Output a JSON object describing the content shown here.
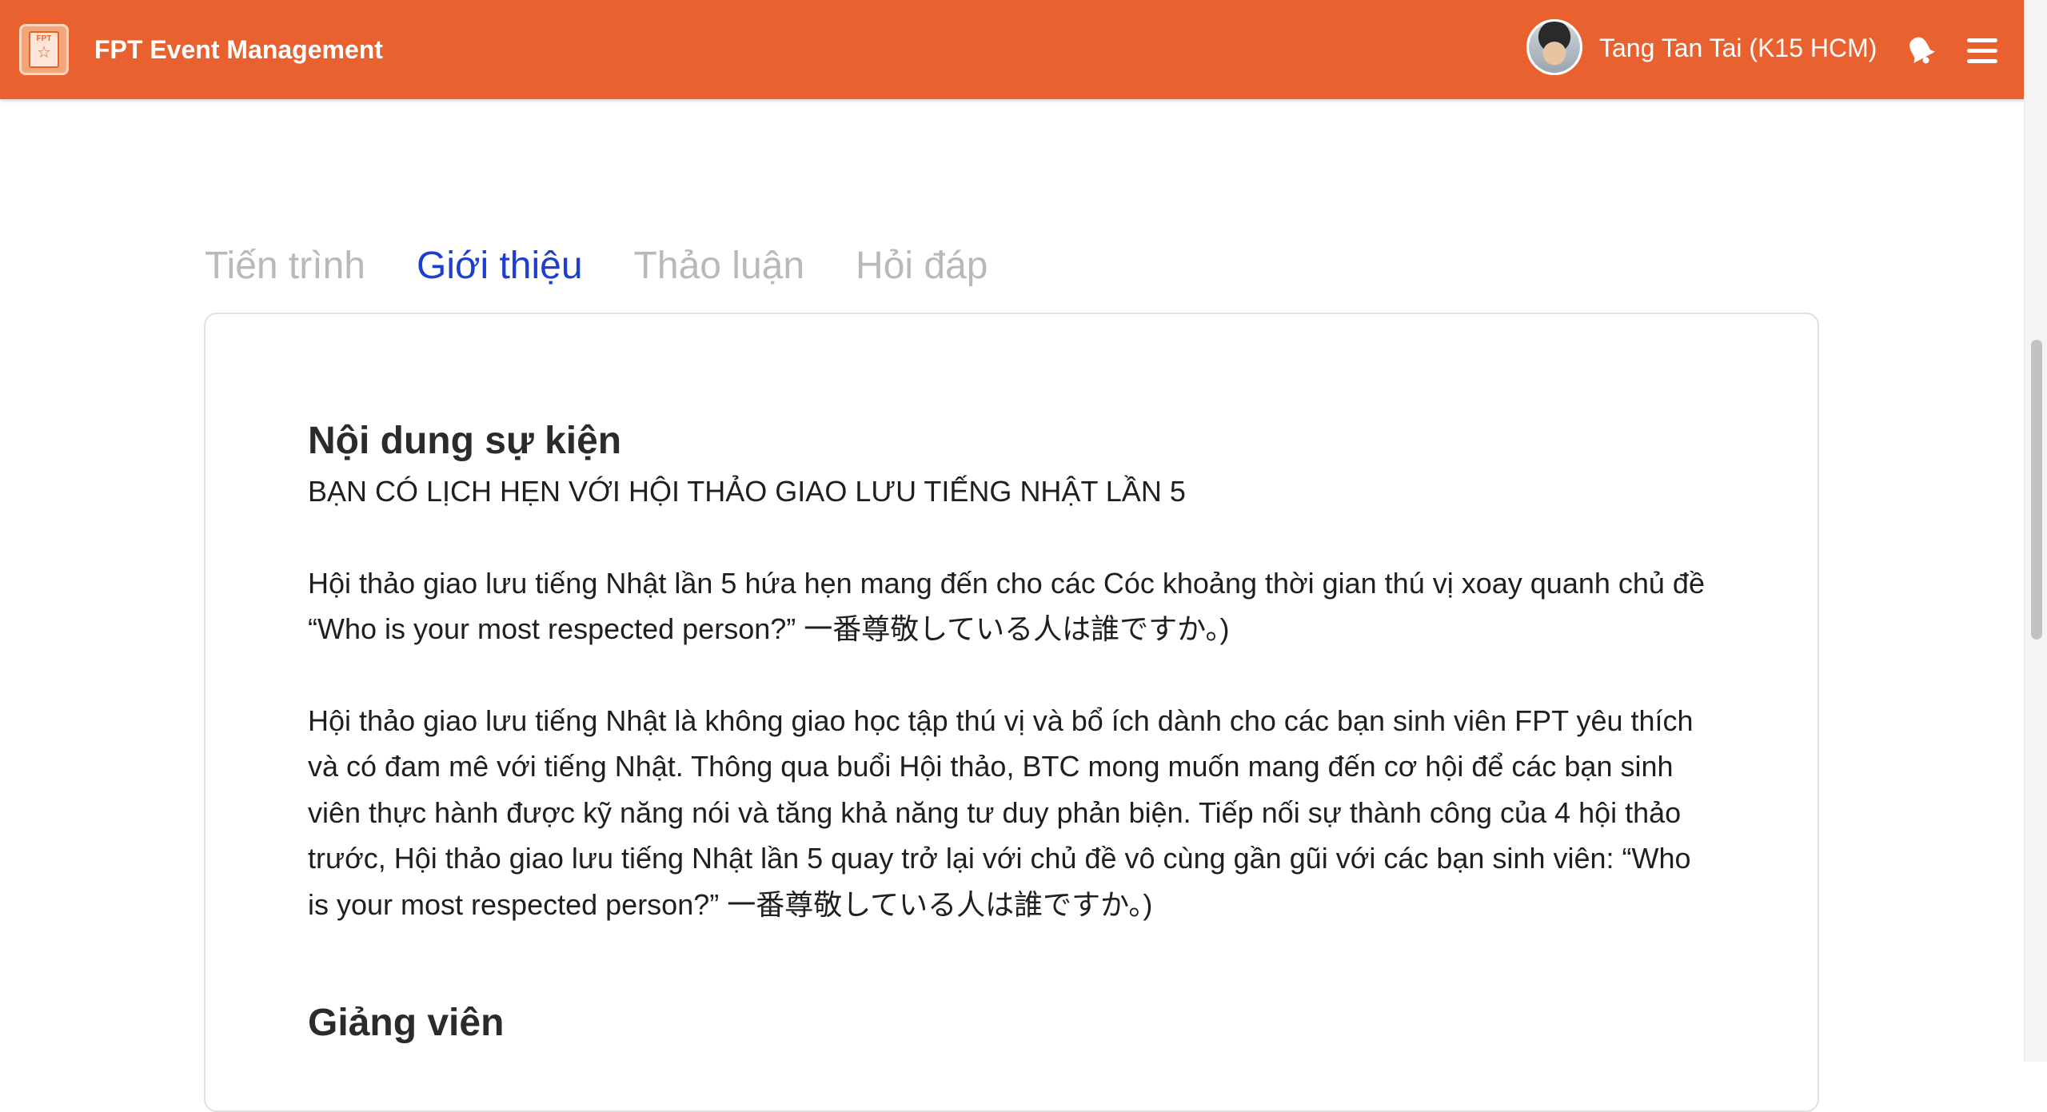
{
  "header": {
    "app_title": "FPT Event Management",
    "logo_text": "FPT",
    "user_name": "Tang Tan Tai (K15 HCM)",
    "icons": [
      "bell-icon",
      "hamburger-menu-icon",
      "avatar"
    ],
    "colors": {
      "header_background": "#e9612f",
      "active_tab": "#1c3fd1",
      "inactive_tab": "#b9b9bd"
    }
  },
  "tabs": [
    {
      "label": "Tiến trình",
      "active": false
    },
    {
      "label": "Giới thiệu",
      "active": true
    },
    {
      "label": "Thảo luận",
      "active": false
    },
    {
      "label": "Hỏi đáp",
      "active": false
    }
  ],
  "content": {
    "section1_title": "Nội dung sự kiện",
    "headline": "BẠN CÓ LỊCH HẸN VỚI HỘI THẢO GIAO LƯU TIẾNG NHẬT LẦN 5",
    "paragraph1": "Hội thảo giao lưu tiếng Nhật lần 5 hứa hẹn mang đến cho các Cóc khoảng thời gian thú vị xoay quanh chủ đề “Who is your most respected person?” 一番尊敬している人は誰ですか。)",
    "paragraph2": "Hội thảo giao lưu tiếng Nhật là không giao học tập thú vị và bổ ích dành cho các bạn sinh viên FPT yêu thích và có đam mê với tiếng Nhật. Thông qua buổi Hội thảo, BTC mong muốn mang đến cơ hội để các bạn sinh viên thực hành được kỹ năng nói và tăng khả năng tư duy phản biện. Tiếp nối sự thành công của 4 hội thảo trước, Hội thảo giao lưu tiếng Nhật lần 5 quay trở lại với chủ đề vô cùng gần gũi với các bạn sinh viên: “Who is your most respected person?” 一番尊敬している人は誰ですか。)",
    "section2_title": "Giảng viên"
  }
}
